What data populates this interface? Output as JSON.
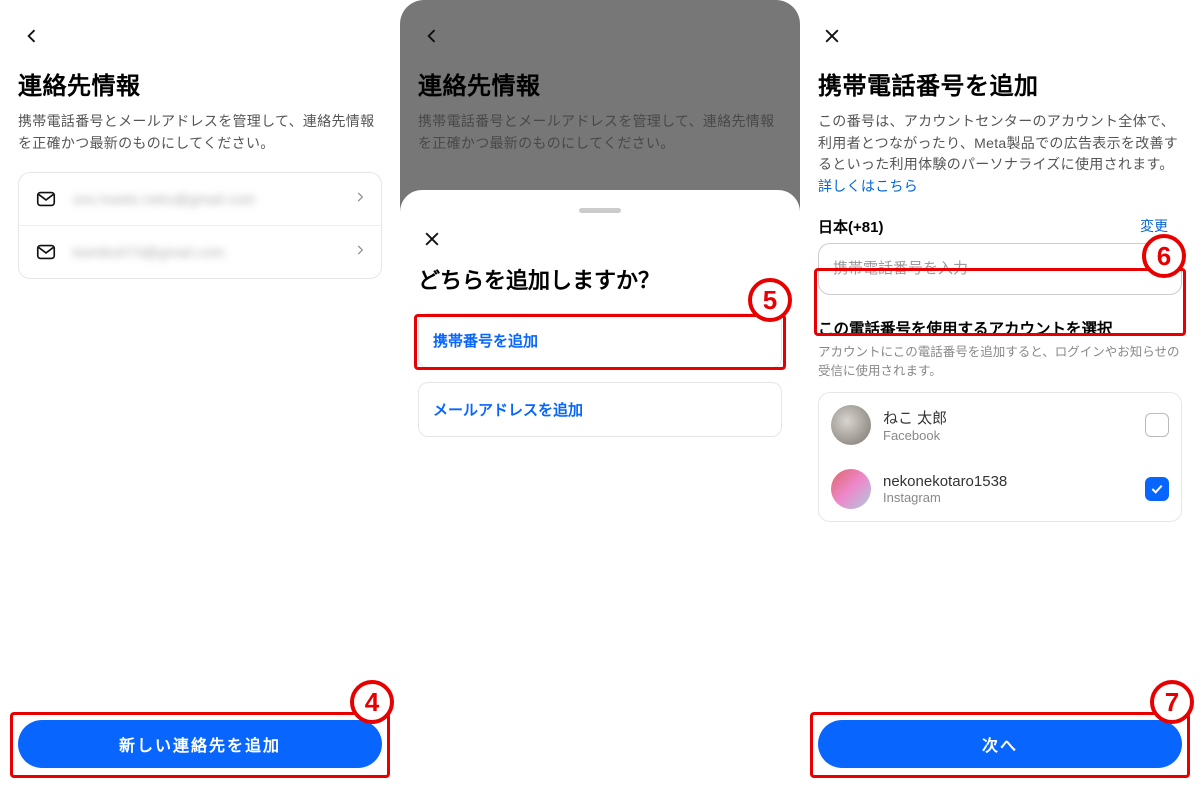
{
  "panel1": {
    "title": "連絡先情報",
    "subtitle": "携帯電話番号とメールアドレスを管理して、連絡先情報を正確かつ最新のものにしてください。",
    "contacts": [
      {
        "masked": "sns.howto.neko@gmail.com"
      },
      {
        "masked": "kamiko073@gmail.com"
      }
    ],
    "add_button": "新しい連絡先を追加"
  },
  "panel2": {
    "title": "連絡先情報",
    "subtitle": "携帯電話番号とメールアドレスを管理して、連絡先情報を正確かつ最新のものにしてください。",
    "sheet_title": "どちらを追加しますか？",
    "option_phone": "携帯番号を追加",
    "option_email": "メールアドレスを追加"
  },
  "panel3": {
    "title": "携帯電話番号を追加",
    "desc": "この番号は、アカウントセンターのアカウント全体で、利用者とつながったり、Meta製品での広告表示を改善するといった利用体験のパーソナライズに使用されます。",
    "more_link": "詳しくはこちら",
    "country_label": "日本(+81)",
    "change_text": "変更",
    "phone_placeholder": "携帯電話番号を入力",
    "section_title": "この電話番号を使用するアカウントを選択",
    "section_desc": "アカウントにこの電話番号を追加すると、ログインやお知らせの受信に使用されます。",
    "accounts": [
      {
        "name": "ねこ 太郎",
        "platform": "Facebook",
        "checked": false
      },
      {
        "name": "nekonekotaro1538",
        "platform": "Instagram",
        "checked": true
      }
    ],
    "next_button": "次へ"
  },
  "callouts": {
    "c4": "4",
    "c5": "5",
    "c6": "6",
    "c7": "7"
  }
}
